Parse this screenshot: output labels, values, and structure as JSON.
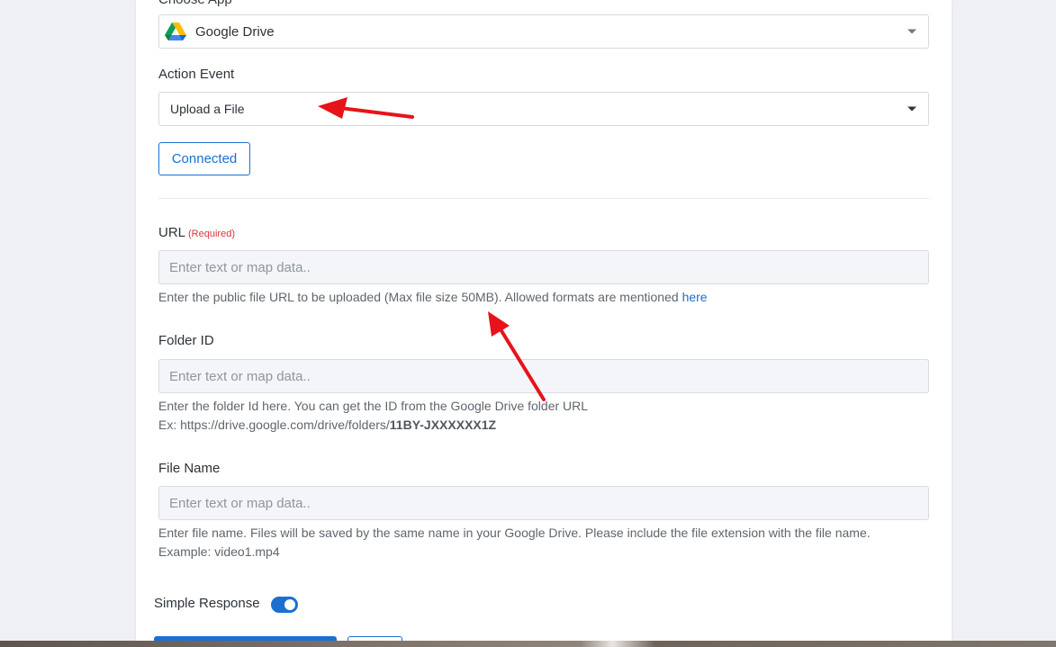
{
  "choose_app": {
    "label": "Choose App",
    "selected": "Google Drive"
  },
  "action_event": {
    "label": "Action Event",
    "selected": "Upload a File"
  },
  "connection": {
    "button_label": "Connected"
  },
  "fields": {
    "url": {
      "label": "URL",
      "required_text": "(Required)",
      "placeholder": "Enter text or map data..",
      "help_text": "Enter the public file URL to be uploaded (Max file size 50MB). Allowed formats are mentioned",
      "help_link": "here"
    },
    "folder_id": {
      "label": "Folder ID",
      "placeholder": "Enter text or map data..",
      "help_line1": "Enter the folder Id here. You can get the ID from the Google Drive folder URL",
      "help_line2_prefix": "Ex: https://drive.google.com/drive/folders/",
      "help_line2_bold": "11BY-JXXXXXX1Z"
    },
    "file_name": {
      "label": "File Name",
      "placeholder": "Enter text or map data..",
      "help_line1": "Enter file name. Files will be saved by the same name in your Google Drive. Please include the file extension with the file name.",
      "help_line2": "Example: video1.mp4"
    }
  },
  "simple_response": {
    "label": "Simple Response",
    "enabled": true
  },
  "colors": {
    "accent": "#1c6fd1",
    "required": "#d9373d",
    "annotation_arrow": "#e8121a"
  },
  "icons": {
    "app_icon": "google-drive-icon",
    "dropdown": "caret-down-icon"
  }
}
